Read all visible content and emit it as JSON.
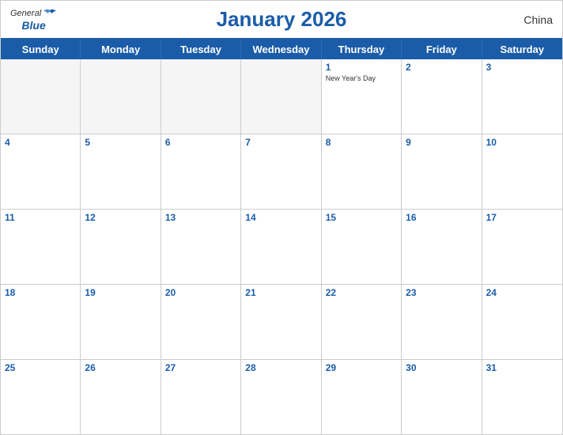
{
  "header": {
    "title": "January 2026",
    "country": "China",
    "logo_general": "General",
    "logo_blue": "Blue"
  },
  "days_of_week": [
    "Sunday",
    "Monday",
    "Tuesday",
    "Wednesday",
    "Thursday",
    "Friday",
    "Saturday"
  ],
  "weeks": [
    [
      {
        "day": "",
        "empty": true
      },
      {
        "day": "",
        "empty": true
      },
      {
        "day": "",
        "empty": true
      },
      {
        "day": "",
        "empty": true
      },
      {
        "day": "1",
        "holiday": "New Year's Day"
      },
      {
        "day": "2"
      },
      {
        "day": "3"
      }
    ],
    [
      {
        "day": "4"
      },
      {
        "day": "5"
      },
      {
        "day": "6"
      },
      {
        "day": "7"
      },
      {
        "day": "8"
      },
      {
        "day": "9"
      },
      {
        "day": "10"
      }
    ],
    [
      {
        "day": "11"
      },
      {
        "day": "12"
      },
      {
        "day": "13"
      },
      {
        "day": "14"
      },
      {
        "day": "15"
      },
      {
        "day": "16"
      },
      {
        "day": "17"
      }
    ],
    [
      {
        "day": "18"
      },
      {
        "day": "19"
      },
      {
        "day": "20"
      },
      {
        "day": "21"
      },
      {
        "day": "22"
      },
      {
        "day": "23"
      },
      {
        "day": "24"
      }
    ],
    [
      {
        "day": "25"
      },
      {
        "day": "26"
      },
      {
        "day": "27"
      },
      {
        "day": "28"
      },
      {
        "day": "29"
      },
      {
        "day": "30"
      },
      {
        "day": "31"
      }
    ]
  ]
}
